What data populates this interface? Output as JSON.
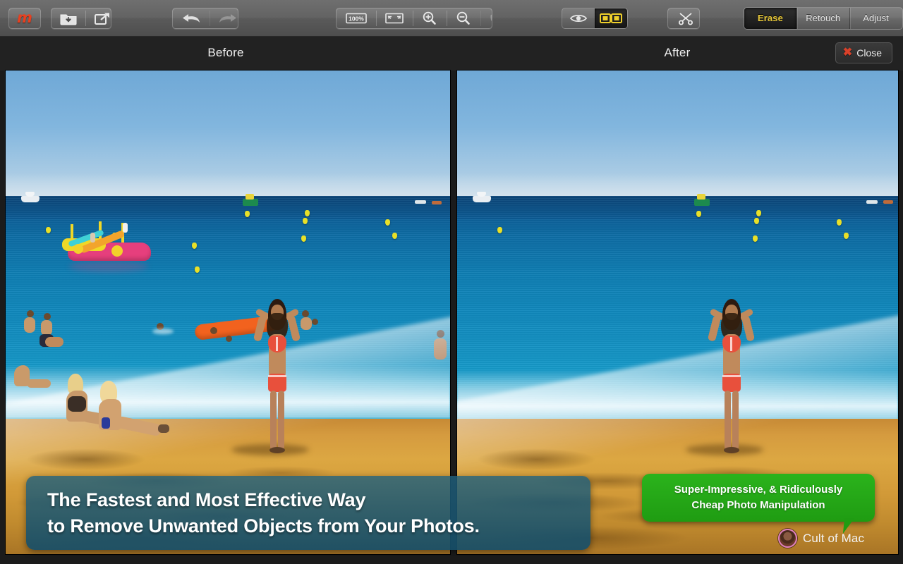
{
  "app": {
    "logo_glyph": "m",
    "logo_color": "#e8401f"
  },
  "toolbar": {
    "file_group": [
      {
        "name": "open-icon",
        "label": "Open"
      },
      {
        "name": "share-icon",
        "label": "Share"
      }
    ],
    "history_group": [
      {
        "name": "undo-icon",
        "label": "Undo"
      },
      {
        "name": "redo-icon",
        "label": "Redo"
      }
    ],
    "zoom_group": [
      {
        "name": "zoom-100-icon",
        "label": "100%"
      },
      {
        "name": "fit-to-window-icon",
        "label": "Fit"
      },
      {
        "name": "zoom-in-icon",
        "label": "Zoom In"
      },
      {
        "name": "zoom-out-icon",
        "label": "Zoom Out"
      },
      {
        "name": "pan-hand-icon",
        "label": "Pan",
        "disabled": true
      }
    ],
    "zoom_level_label": "100%",
    "view_group": [
      {
        "name": "preview-eye-icon",
        "label": "Preview",
        "active": false
      },
      {
        "name": "split-compare-icon",
        "label": "Compare",
        "active": true
      }
    ],
    "crop_group": [
      {
        "name": "crop-scissors-icon",
        "label": "Crop"
      }
    ],
    "mode_tabs": [
      {
        "label": "Erase",
        "active": true
      },
      {
        "label": "Retouch",
        "active": false
      },
      {
        "label": "Adjust",
        "active": false
      }
    ],
    "active_tab_color": "#e9c93a"
  },
  "header": {
    "before_label": "Before",
    "after_label": "After",
    "close_label": "Close",
    "close_icon_glyph": "✖",
    "close_icon_color": "#d9412a"
  },
  "panels": {
    "before": {
      "name": "before-image",
      "alt": "Beach scene with many swimmers, an orange float, a pink and yellow pedalo water slide, sunbathers on the sand and a woman in a red bikini standing at the shoreline"
    },
    "after": {
      "name": "after-image",
      "alt": "The same beach scene with the swimmers, orange float, pedalo and sunbathers erased, leaving only the woman in the red bikini and distant boats"
    }
  },
  "overlays": {
    "headline": {
      "line1": "The Fastest and Most Effective Way",
      "line2": "to Remove Unwanted Objects from Your Photos.",
      "background_color": "#1d5f7d"
    },
    "callout": {
      "line1": "Super-Impressive, & Ridiculously",
      "line2": "Cheap Photo Manipulation",
      "background_color": "#22a817"
    },
    "attribution": {
      "name": "Cult of Mac"
    }
  }
}
